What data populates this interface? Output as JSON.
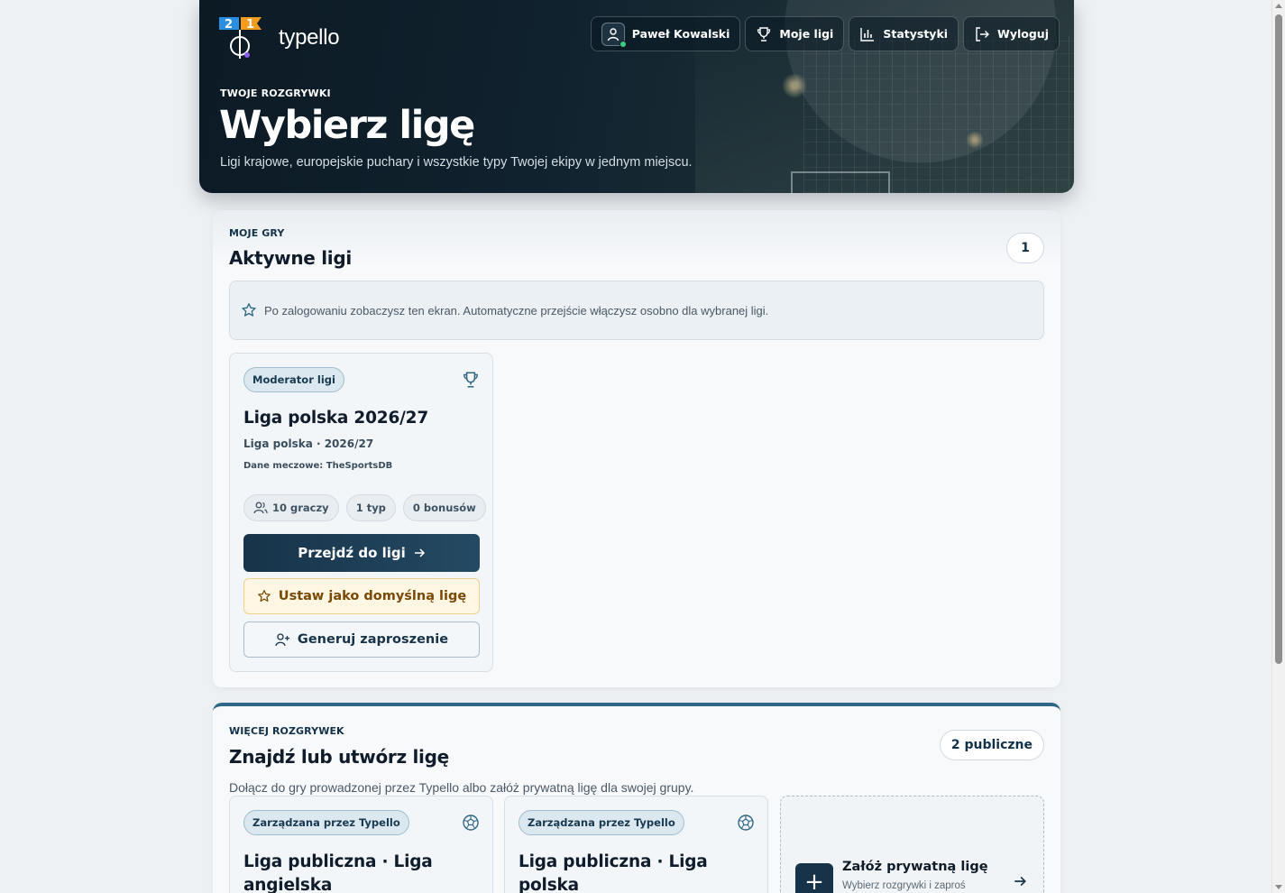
{
  "brand": {
    "name": "typello"
  },
  "nav": {
    "user": "Paweł Kowalski",
    "my_leagues": "Moje ligi",
    "stats": "Statystyki",
    "logout": "Wyloguj"
  },
  "hero": {
    "eyebrow": "TWOJE ROZGRYWKI",
    "title": "Wybierz ligę",
    "subtitle": "Ligi krajowe, europejskie puchary i wszystkie typy Twojej ekipy w jednym miejscu."
  },
  "my_games": {
    "eyebrow": "MOJE GRY",
    "title": "Aktywne ligi",
    "count": "1",
    "info": "Po zalogowaniu zobaczysz ten ekran. Automatyczne przejście włączysz osobno dla wybranej ligi.",
    "league": {
      "badge": "Moderator ligi",
      "name": "Liga polska 2026/27",
      "meta": "Liga polska · 2026/27",
      "source": "Dane meczowe: TheSportsDB",
      "stat_players": "10 graczy",
      "stat_tips": "1 typ",
      "stat_bonus": "0 bonusów",
      "btn_go": "Przejdź do ligi",
      "btn_default": "Ustaw jako domyślną ligę",
      "btn_invite": "Generuj zaproszenie"
    }
  },
  "more_games": {
    "eyebrow": "WIĘCEJ ROZGRYWEK",
    "title": "Znajdź lub utwórz ligę",
    "count": "2 publiczne",
    "description": "Dołącz do gry prowadzonej przez Typello albo załóż prywatną ligę dla swojej grupy.",
    "public_leagues": [
      {
        "badge": "Zarządzana przez Typello",
        "name": "Liga publiczna · Liga angielska"
      },
      {
        "badge": "Zarządzana przez Typello",
        "name": "Liga publiczna · Liga polska"
      }
    ],
    "create": {
      "title": "Załóż prywatną ligę",
      "subtitle": "Wybierz rozgrywki i zaproś"
    }
  },
  "colors": {
    "hero_bg": "#0c1a24",
    "primary": "#173349",
    "accent_bar": "#2f6786",
    "default_btn_bg": "#fff6e3",
    "online_dot": "#3ccf7d"
  },
  "icons": {
    "user": "user-icon",
    "trophy": "trophy-icon",
    "chart": "bar-chart-icon",
    "logout": "logout-icon",
    "star": "star-icon",
    "ball": "soccer-ball-icon",
    "arrow": "arrow-right-icon",
    "plus": "plus-icon"
  }
}
